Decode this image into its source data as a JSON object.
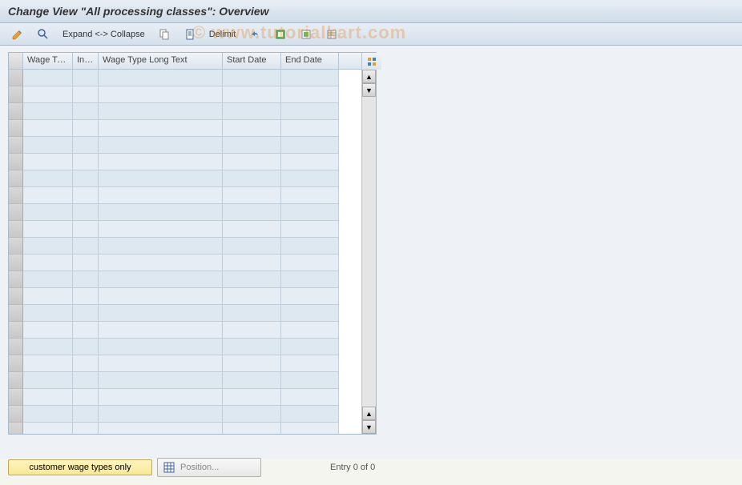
{
  "title": "Change View \"All processing classes\": Overview",
  "toolbar": {
    "expand": "Expand <-> Collapse",
    "delimit": "Delimit"
  },
  "table": {
    "headers": {
      "wage_type": "Wage Ty...",
      "inf": "Inf...",
      "long_text": "Wage Type Long Text",
      "start_date": "Start Date",
      "end_date": "End Date"
    }
  },
  "footer": {
    "customer_btn": "customer wage types only",
    "position_btn": "Position...",
    "entry_status": "Entry 0 of 0"
  },
  "watermark": "© www.tutorialkart.com"
}
